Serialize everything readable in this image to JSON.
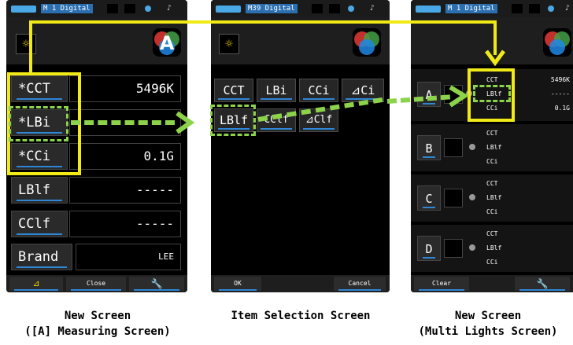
{
  "screens": {
    "measuring": {
      "status_tag": "M 1 Digital",
      "rows": [
        {
          "label": "*CCT",
          "value": "5496K"
        },
        {
          "label": "*LBi",
          "value": ""
        },
        {
          "label": "*CCi",
          "value": "0.1G"
        },
        {
          "label": "LBlf",
          "value": "-----"
        },
        {
          "label": "CClf",
          "value": "-----"
        },
        {
          "label": "Brand",
          "value": "LEE"
        }
      ],
      "bottom": {
        "delta": "⊿",
        "close": "Close",
        "tool": "wrench-icon"
      },
      "caption_line1": "New Screen",
      "caption_line2": "([A] Measuring Screen)"
    },
    "selection": {
      "status_tag": "M39 Digital",
      "items_row1": [
        "CCT",
        "LBi",
        "CCi",
        "⊿Ci"
      ],
      "items_row2": [
        "LBlf",
        "CClf",
        "⊿Clf"
      ],
      "bottom": {
        "ok": "OK",
        "cancel": "Cancel"
      },
      "caption": "Item Selection Screen"
    },
    "multi": {
      "status_tag": "M 1 Digital",
      "lights": [
        {
          "name": "A",
          "items": [
            "CCT",
            "LBlf",
            "CCi"
          ],
          "values": [
            "5496K",
            "-----",
            "0.1G"
          ]
        },
        {
          "name": "B",
          "items": [
            "CCT",
            "LBlf",
            "CCi"
          ],
          "values": [
            "",
            "",
            ""
          ]
        },
        {
          "name": "C",
          "items": [
            "CCT",
            "LBlf",
            "CCi"
          ],
          "values": [
            "",
            "",
            ""
          ]
        },
        {
          "name": "D",
          "items": [
            "CCT",
            "LBlf",
            "CCi"
          ],
          "values": [
            "",
            "",
            ""
          ]
        }
      ],
      "bottom": {
        "clear": "Clear",
        "tool": "wrench-icon"
      },
      "caption_line1": "New Screen",
      "caption_line2": "(Multi Lights Screen)"
    }
  },
  "colors": {
    "highlight_yellow": "#f0ea16",
    "highlight_green": "#8cd24a",
    "accent_blue": "#2e86d6"
  }
}
